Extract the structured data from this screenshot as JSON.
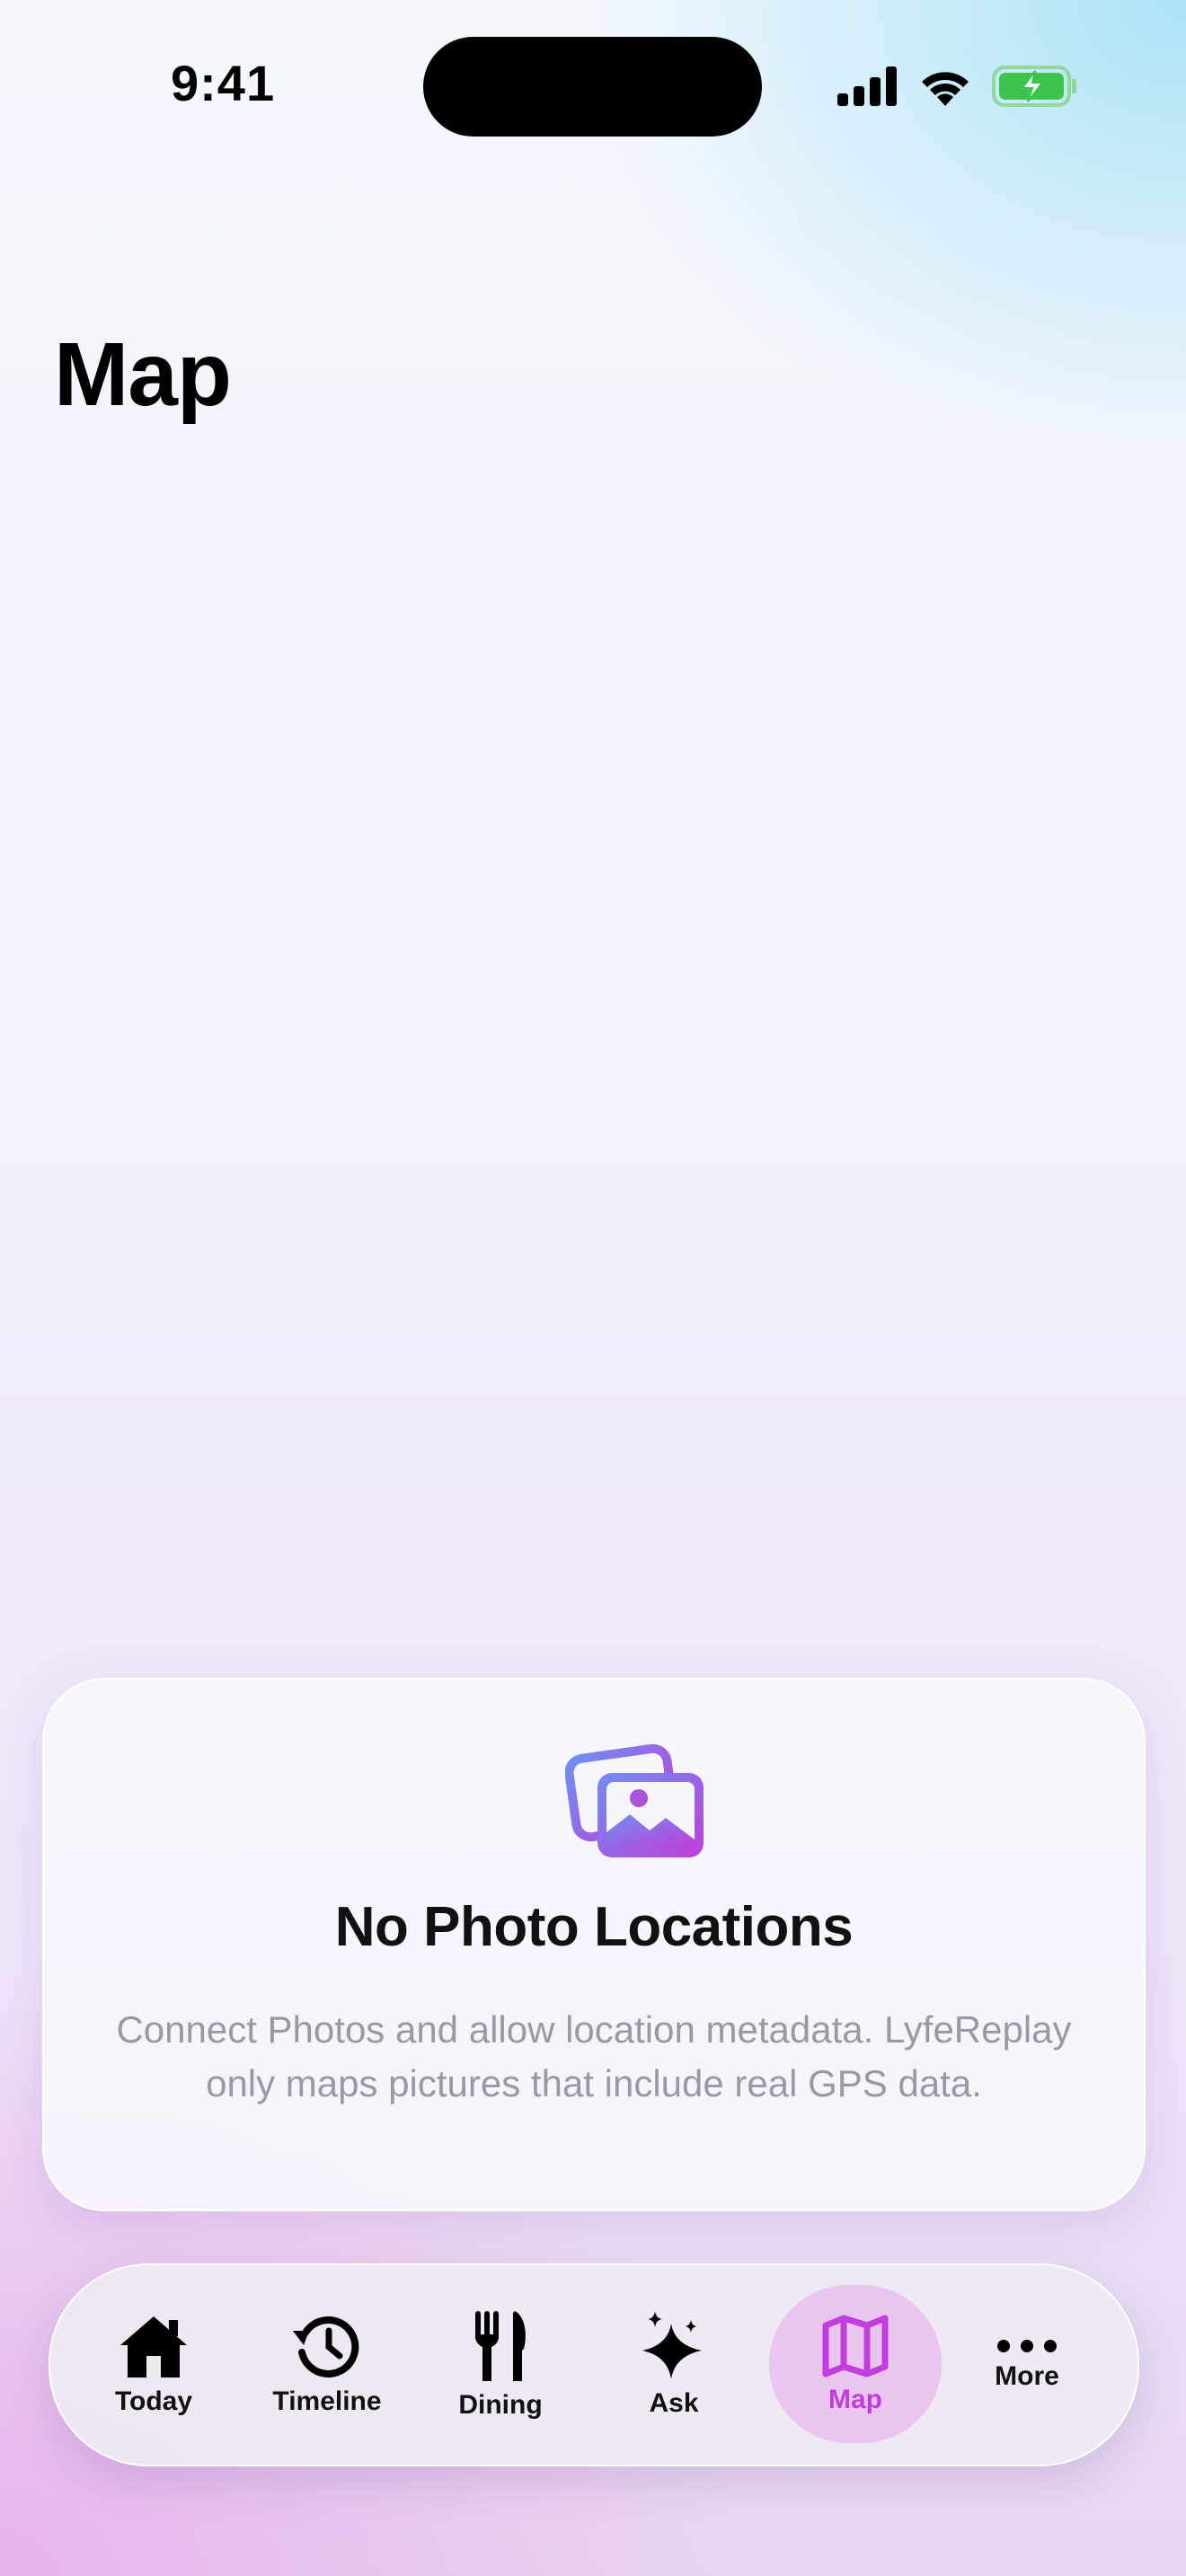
{
  "status_bar": {
    "time": "9:41",
    "icons": [
      "cellular-signal-icon",
      "wifi-icon",
      "battery-charging-icon"
    ],
    "battery_color": "#3ec34f"
  },
  "header": {
    "title": "Map"
  },
  "empty_state": {
    "icon": "photo-stack-icon",
    "title": "No Photo Locations",
    "body": "Connect Photos and allow location metadata. LyfeReplay only maps pictures that include real GPS data."
  },
  "tab_bar": {
    "accent_color": "#c13ddd",
    "tabs": [
      {
        "label": "Today",
        "icon": "house-icon"
      },
      {
        "label": "Timeline",
        "icon": "clock-history-icon"
      },
      {
        "label": "Dining",
        "icon": "fork-knife-icon"
      },
      {
        "label": "Ask",
        "icon": "sparkles-icon"
      },
      {
        "label": "Map",
        "icon": "map-icon",
        "selected": true
      },
      {
        "label": "More",
        "icon": "ellipsis-icon"
      }
    ]
  }
}
